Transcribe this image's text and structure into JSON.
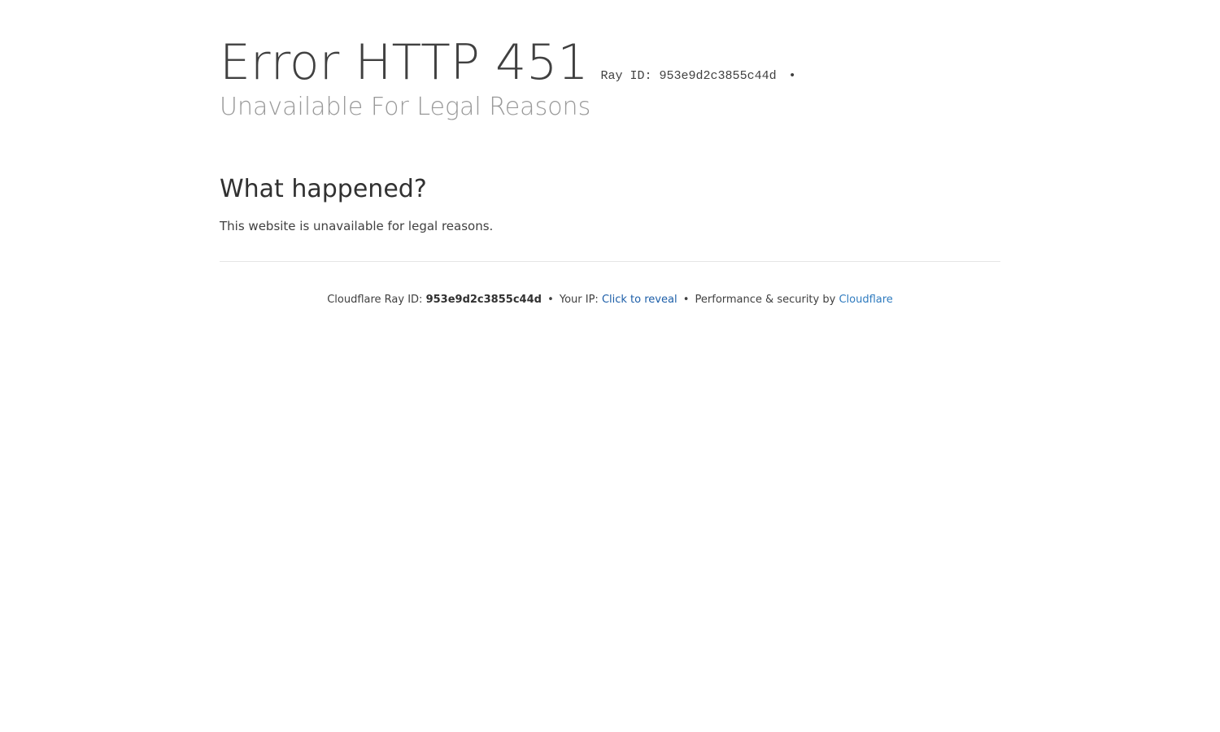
{
  "header": {
    "error_title": "Error HTTP 451",
    "ray_inline_label": "Ray ID:",
    "ray_inline_value": "953e9d2c3855c44d",
    "ray_inline_bullet": "•",
    "subtitle": "Unavailable For Legal Reasons"
  },
  "main": {
    "what_happened_title": "What happened?",
    "what_happened_text": "This website is unavailable for legal reasons."
  },
  "footer": {
    "ray_label": "Cloudflare Ray ID:",
    "ray_value": "953e9d2c3855c44d",
    "bullet": "•",
    "ip_label": "Your IP:",
    "ip_reveal_link": "Click to reveal",
    "perf_label": "Performance & security by",
    "cloudflare_link": "Cloudflare"
  },
  "colors": {
    "text": "#404040",
    "subtitle": "#999999",
    "link": "#2f7bbf",
    "divider": "#e6e6e6"
  }
}
